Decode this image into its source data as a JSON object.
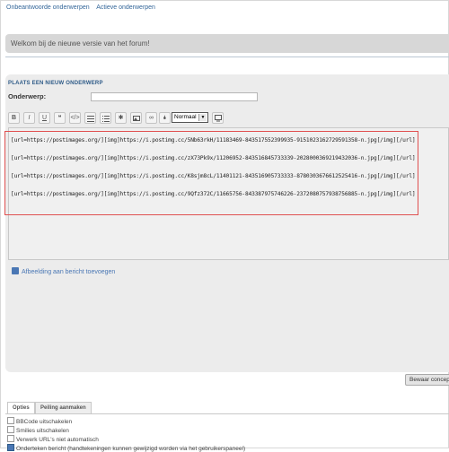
{
  "nav": {
    "unanswered": "Onbeantwoorde onderwerpen",
    "active": "Actieve onderwerpen"
  },
  "announcement": {
    "text": "Welkom bij de nieuwe versie van het forum!"
  },
  "post": {
    "title": "PLAATS EEN NIEUW ONDERWERP",
    "subject_label": "Onderwerp:",
    "subject_value": "",
    "font_size_select": "Normaal",
    "toolbar_icons": [
      "bold-icon",
      "italic-icon",
      "underline-icon",
      "quote-icon",
      "code-icon",
      "list-icon",
      "ordered-list-icon",
      "list-item-icon",
      "image-icon",
      "link-icon",
      "color-icon",
      "font-size-icon",
      "preview-icon"
    ],
    "body_lines": [
      "[url=https://postimages.org/][img]https://i.postimg.cc/5Nb63rkH/11183469-843517552399935-9151023162729591358-n.jpg[/img][/url]",
      "[url=https://postimages.org/][img]https://i.postimg.cc/zX73Pk9x/11206952-843516845733339-2028000369219432036-n.jpg[/img][/url]",
      "[url=https://postimages.org/][img]https://i.postimg.cc/K8sjm8cL/11401121-843516905733333-8780303676612525416-n.jpg[/img][/url]",
      "[url=https://postimages.org/][img]https://i.postimg.cc/9Qfz372C/11665756-843387975746226-2372080757938756885-n.jpg[/img][/url]"
    ],
    "add_image_link": "Afbeelding aan bericht toevoegen",
    "save_button": "Bewaar concept"
  },
  "tabs": {
    "options": "Opties",
    "poll": "Peiling aanmaken"
  },
  "options": [
    {
      "label": "BBCode uitschakelen",
      "checked": false
    },
    {
      "label": "Smilies uitschakelen",
      "checked": false
    },
    {
      "label": "Verwerk URL's niet automatisch",
      "checked": false
    },
    {
      "label": "Onderteken bericht (handtekeningen kunnen gewijzigd worden via het gebruikerspaneel)",
      "checked": true
    }
  ],
  "colors": {
    "link": "#336699",
    "highlight_border": "#e05050",
    "panel": "#ececec"
  }
}
